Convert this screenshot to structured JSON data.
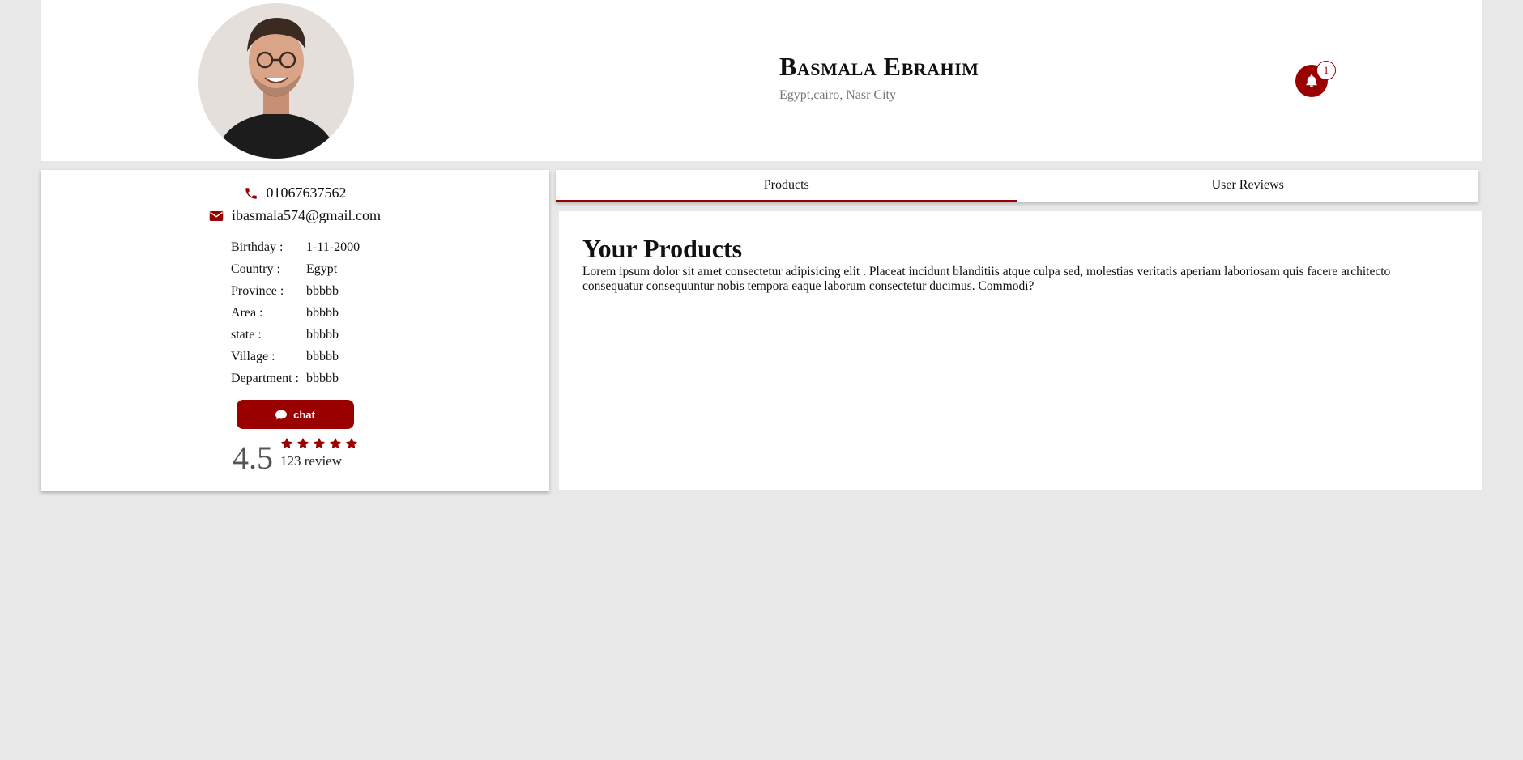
{
  "profile": {
    "name": "Basmala Ebrahim",
    "location": "Egypt,cairo, Nasr City",
    "notifications_count": "1"
  },
  "contact": {
    "phone": "01067637562",
    "email": "ibasmala574@gmail.com"
  },
  "details": [
    {
      "label": "Birthday :",
      "value": "1-11-2000"
    },
    {
      "label": "Country :",
      "value": "Egypt"
    },
    {
      "label": "Province :",
      "value": "bbbbb"
    },
    {
      "label": "Area :",
      "value": "bbbbb"
    },
    {
      "label": "state :",
      "value": "bbbbb"
    },
    {
      "label": "Village :",
      "value": "bbbbb"
    },
    {
      "label": "Department :",
      "value": "bbbbb"
    }
  ],
  "chat_label": "chat",
  "rating": {
    "value": "4.5",
    "stars": 5,
    "review_count": "123 review"
  },
  "tabs": [
    {
      "label": "Products",
      "active": true
    },
    {
      "label": "User Reviews",
      "active": false
    }
  ],
  "content": {
    "title": "Your Products",
    "text": "Lorem ipsum dolor sit amet consectetur adipisicing elit . Placeat incidunt blanditiis atque culpa sed, molestias veritatis aperiam laboriosam quis facere architecto consequatur consequuntur nobis tempora eaque laborum consectetur ducimus. Commodi?"
  },
  "colors": {
    "accent": "#9b0000",
    "background": "#e8e8e8"
  },
  "icons": [
    "bell-icon",
    "phone-icon",
    "envelope-icon",
    "comment-icon",
    "star-icon"
  ]
}
